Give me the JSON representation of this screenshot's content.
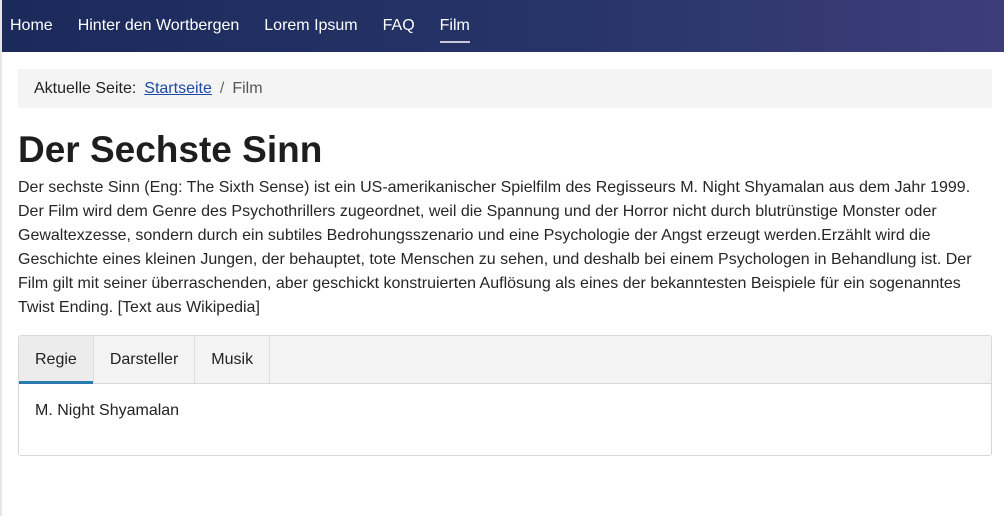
{
  "nav": {
    "items": [
      {
        "label": "Home"
      },
      {
        "label": "Hinter den Wortbergen"
      },
      {
        "label": "Lorem Ipsum"
      },
      {
        "label": "FAQ"
      },
      {
        "label": "Film"
      }
    ]
  },
  "breadcrumb": {
    "prefix": "Aktuelle Seite:",
    "home_link": "Startseite",
    "separator": "/",
    "current": "Film"
  },
  "page": {
    "title": "Der Sechste Sinn",
    "description": "Der sechste Sinn (Eng: The Sixth Sense) ist ein US-amerikanischer Spielfilm des Regisseurs M. Night Shyamalan aus dem Jahr 1999. Der Film wird dem Genre des Psychothrillers zugeordnet, weil die Spannung und der Horror nicht durch blutrünstige Monster oder Gewaltexzesse, sondern durch ein subtiles Bedrohungsszenario und eine Psychologie der Angst erzeugt werden.Erzählt wird die Geschichte eines kleinen Jungen, der behauptet, tote Menschen zu sehen, und deshalb bei einem Psychologen in Behandlung ist. Der Film gilt mit seiner überraschenden, aber geschickt konstruierten Auflösung als eines der bekanntesten Beispiele für ein sogenanntes Twist Ending. [Text aus Wikipedia]"
  },
  "tabs": {
    "items": [
      {
        "label": "Regie"
      },
      {
        "label": "Darsteller"
      },
      {
        "label": "Musik"
      }
    ],
    "active_content": "M. Night Shyamalan"
  }
}
